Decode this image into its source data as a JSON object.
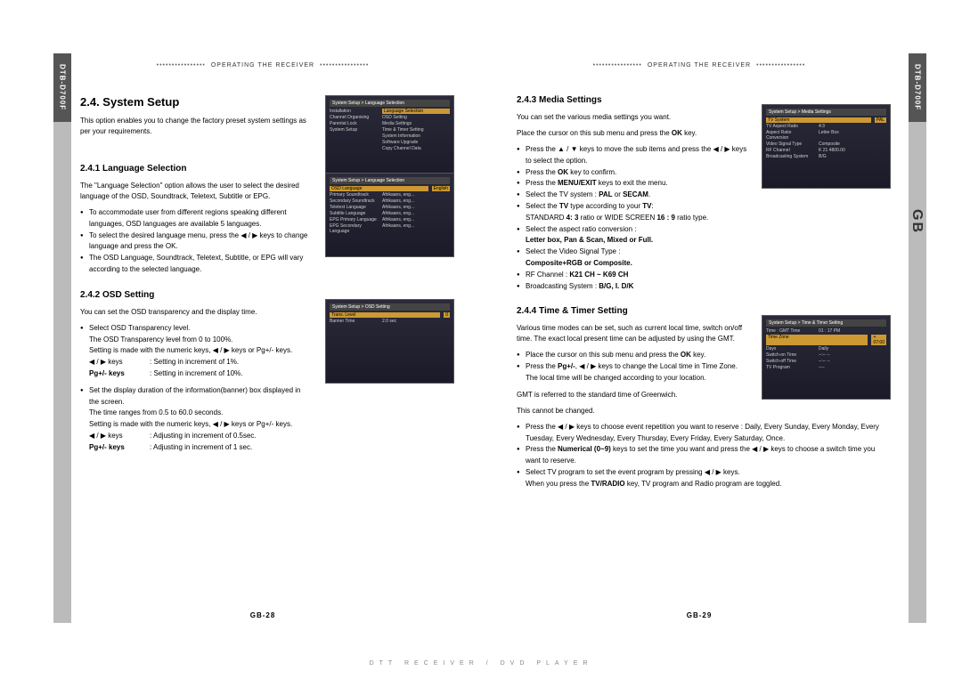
{
  "model": "DTB-D700F",
  "header": "OPERATING THE RECEIVER",
  "side_gb": "GB",
  "footer_left": "GB-28",
  "footer_right": "GB-29",
  "footer_mid": "DTT RECEIVER / DVD PLAYER",
  "left": {
    "h1": "2.4. System Setup",
    "intro": "This option enables you to change the factory preset system settings as per your requirements.",
    "s1_h": "2.4.1 Language Selection",
    "s1_p": "The \"Language Selection\" option allows the user to select the desired language of the OSD, Soundtrack, Teletext, Subtitle or EPG.",
    "s1_li1": "To accommodate user from different regions speaking different languages, OSD languages are available 5 languages.",
    "s1_li2": "To select the desired language menu, press the ◀ / ▶ keys to change language and press the OK.",
    "s1_li3": "The OSD Language, Soundtrack, Teletext, Subtitle, or EPG will vary according to the selected language.",
    "s2_h": "2.4.2 OSD Setting",
    "s2_p": "You can set the OSD transparency and the display time.",
    "s2_li1": "Select OSD Transparency level.",
    "s2_li1b": "The OSD Transparency level from 0 to 100%.",
    "s2_li1c": "Setting is made with the numeric keys, ◀ / ▶ keys or Pg+/- keys.",
    "s2_kv1k": "◀ / ▶ keys",
    "s2_kv1v": ": Setting in increment of 1%.",
    "s2_kv2k": "Pg+/- keys",
    "s2_kv2v": ": Setting in increment of 10%.",
    "s2_li2": "Set the display duration of the information(banner) box displayed in the screen.",
    "s2_li2b": "The time ranges from 0.5 to 60.0 seconds.",
    "s2_li2c": "Setting is made with the numeric keys, ◀ / ▶ keys or Pg+/- keys.",
    "s2_kv3k": "◀ / ▶ keys",
    "s2_kv3v": ": Adjusting in increment of 0.5sec.",
    "s2_kv4k": "Pg+/- keys",
    "s2_kv4v": ": Adjusting in increment of 1 sec."
  },
  "right": {
    "s3_h": "2.4.3 Media Settings",
    "s3_p1": "You can set the various media settings you want.",
    "s3_p2_a": "Place the cursor on this sub menu and press the ",
    "s3_p2_b": "OK",
    "s3_p2_c": " key.",
    "s3_li1": "Press the ▲ / ▼ keys to move the sub items and press the ◀ / ▶ keys to select the option.",
    "s3_li2a": "Press the ",
    "s3_li2b": "OK",
    "s3_li2c": " key to confirm.",
    "s3_li3a": "Press the ",
    "s3_li3b": "MENU/EXIT",
    "s3_li3c": " keys to exit the menu.",
    "s3_li4a": "Select the TV system : ",
    "s3_li4b": "PAL",
    "s3_li4c": " or ",
    "s3_li4d": "SECAM",
    "s3_li4e": ".",
    "s3_li5a": "Select the ",
    "s3_li5b": "TV",
    "s3_li5c": " type according to your ",
    "s3_li5d": "TV",
    "s3_li5e": ":",
    "s3_li5f": "STANDARD ",
    "s3_li5g": "4: 3",
    "s3_li5h": " ratio or WIDE SCREEN ",
    "s3_li5i": "16 : 9",
    "s3_li5j": " ratio type.",
    "s3_li6": "Select the aspect ratio conversion :",
    "s3_li6b": "Letter box, Pan & Scan, Mixed or Full.",
    "s3_li7": "Select the Video Signal Type :",
    "s3_li7b": "Composite+RGB or Composite.",
    "s3_li8a": "RF Channel : ",
    "s3_li8b": "K21 CH ~ K69 CH",
    "s3_li9a": "Broadcasting System : ",
    "s3_li9b": "B/G, I. D/K",
    "s4_h": "2.4.4 Time & Timer Setting",
    "s4_p": "Various time modes can be set, such as current local time, switch on/off time. The exact local present time can be adjusted by using the GMT.",
    "s4_li1a": "Place the cursor on this sub menu and press the ",
    "s4_li1b": "OK",
    "s4_li1c": " key.",
    "s4_li2a": "Press the ",
    "s4_li2b": "Pg+/-",
    "s4_li2c": ", ◀ / ▶ keys to change the Local time in Time Zone. The local time will be changed according to your location.",
    "s4_p2": "GMT is referred to the standard time of Greenwich.",
    "s4_p3": "This cannot be changed.",
    "s4_li3": "Press the ◀ / ▶ keys to choose event repetition you want to reserve : Daily, Every Sunday, Every Monday, Every Tuesday, Every Wednesday, Every Thursday, Every Friday, Every Saturday, Once.",
    "s4_li4a": "Press the ",
    "s4_li4b": "Numerical (0~9)",
    "s4_li4c": " keys to set the time you want and press the ◀ / ▶ keys to choose a switch time you want to reserve.",
    "s4_li5a": "Select TV program to set the event program by pressing ◀ / ▶ keys.",
    "s4_li5b": "When you press the ",
    "s4_li5c": "TV/RADIO",
    "s4_li5d": " key, TV program and Radio program are toggled."
  },
  "fig_left1": {
    "title": "System Setup > Language Selection",
    "rows": [
      "Installation",
      "Channel Organising",
      "Parental Lock",
      "System Setup"
    ],
    "right": [
      "Language Selection",
      "OSD Setting",
      "Media Settings",
      "Time & Timer Setting",
      "System Information",
      "Software Upgrade",
      "Copy Channel Data"
    ]
  },
  "fig_left2": {
    "title": "System Setup > Language Selection",
    "rows": [
      [
        "OSD Language",
        "English"
      ],
      [
        "Primary Soundtrack",
        "Afrikaans, eng..."
      ],
      [
        "Secondary Soundtrack",
        "Afrikaans, eng..."
      ],
      [
        "Teletext Language",
        "Afrikaans, eng..."
      ],
      [
        "Subtitle Language",
        "Afrikaans, eng..."
      ],
      [
        "EPG Primary Language",
        "Afrikaans, eng..."
      ],
      [
        "EPG Secondary Language",
        "Afrikaans, eng..."
      ]
    ]
  },
  "fig_left3": {
    "title": "System Setup > OSD Setting",
    "rows": [
      [
        "Trans. Level",
        "0"
      ],
      [
        "Banner Time",
        "2.0 sec"
      ]
    ]
  },
  "fig_right1": {
    "title": "System Setup > Media Settings",
    "rows": [
      [
        "TV System",
        "PAL"
      ],
      [
        "TV Aspect Ratio",
        "4:3"
      ],
      [
        "Aspect Ratio Conversion",
        "Letter Box"
      ],
      [
        "Video Signal Type",
        "Composite"
      ],
      [
        "RF Channel",
        "K 21 4800.00"
      ],
      [
        "Broadcasting System",
        "B/G"
      ]
    ]
  },
  "fig_right2": {
    "title": "System Setup > Time & Timer Setting",
    "rows": [
      [
        "Time : GMT Time",
        "01 : 17 PM"
      ],
      [
        "Time Zone",
        "+ 07:00"
      ],
      [
        "Days",
        "Daily"
      ],
      [
        "Switch-on Time",
        "--:-- --"
      ],
      [
        "Switch-off Time",
        "--:-- --"
      ],
      [
        "TV Program",
        "----"
      ]
    ]
  }
}
